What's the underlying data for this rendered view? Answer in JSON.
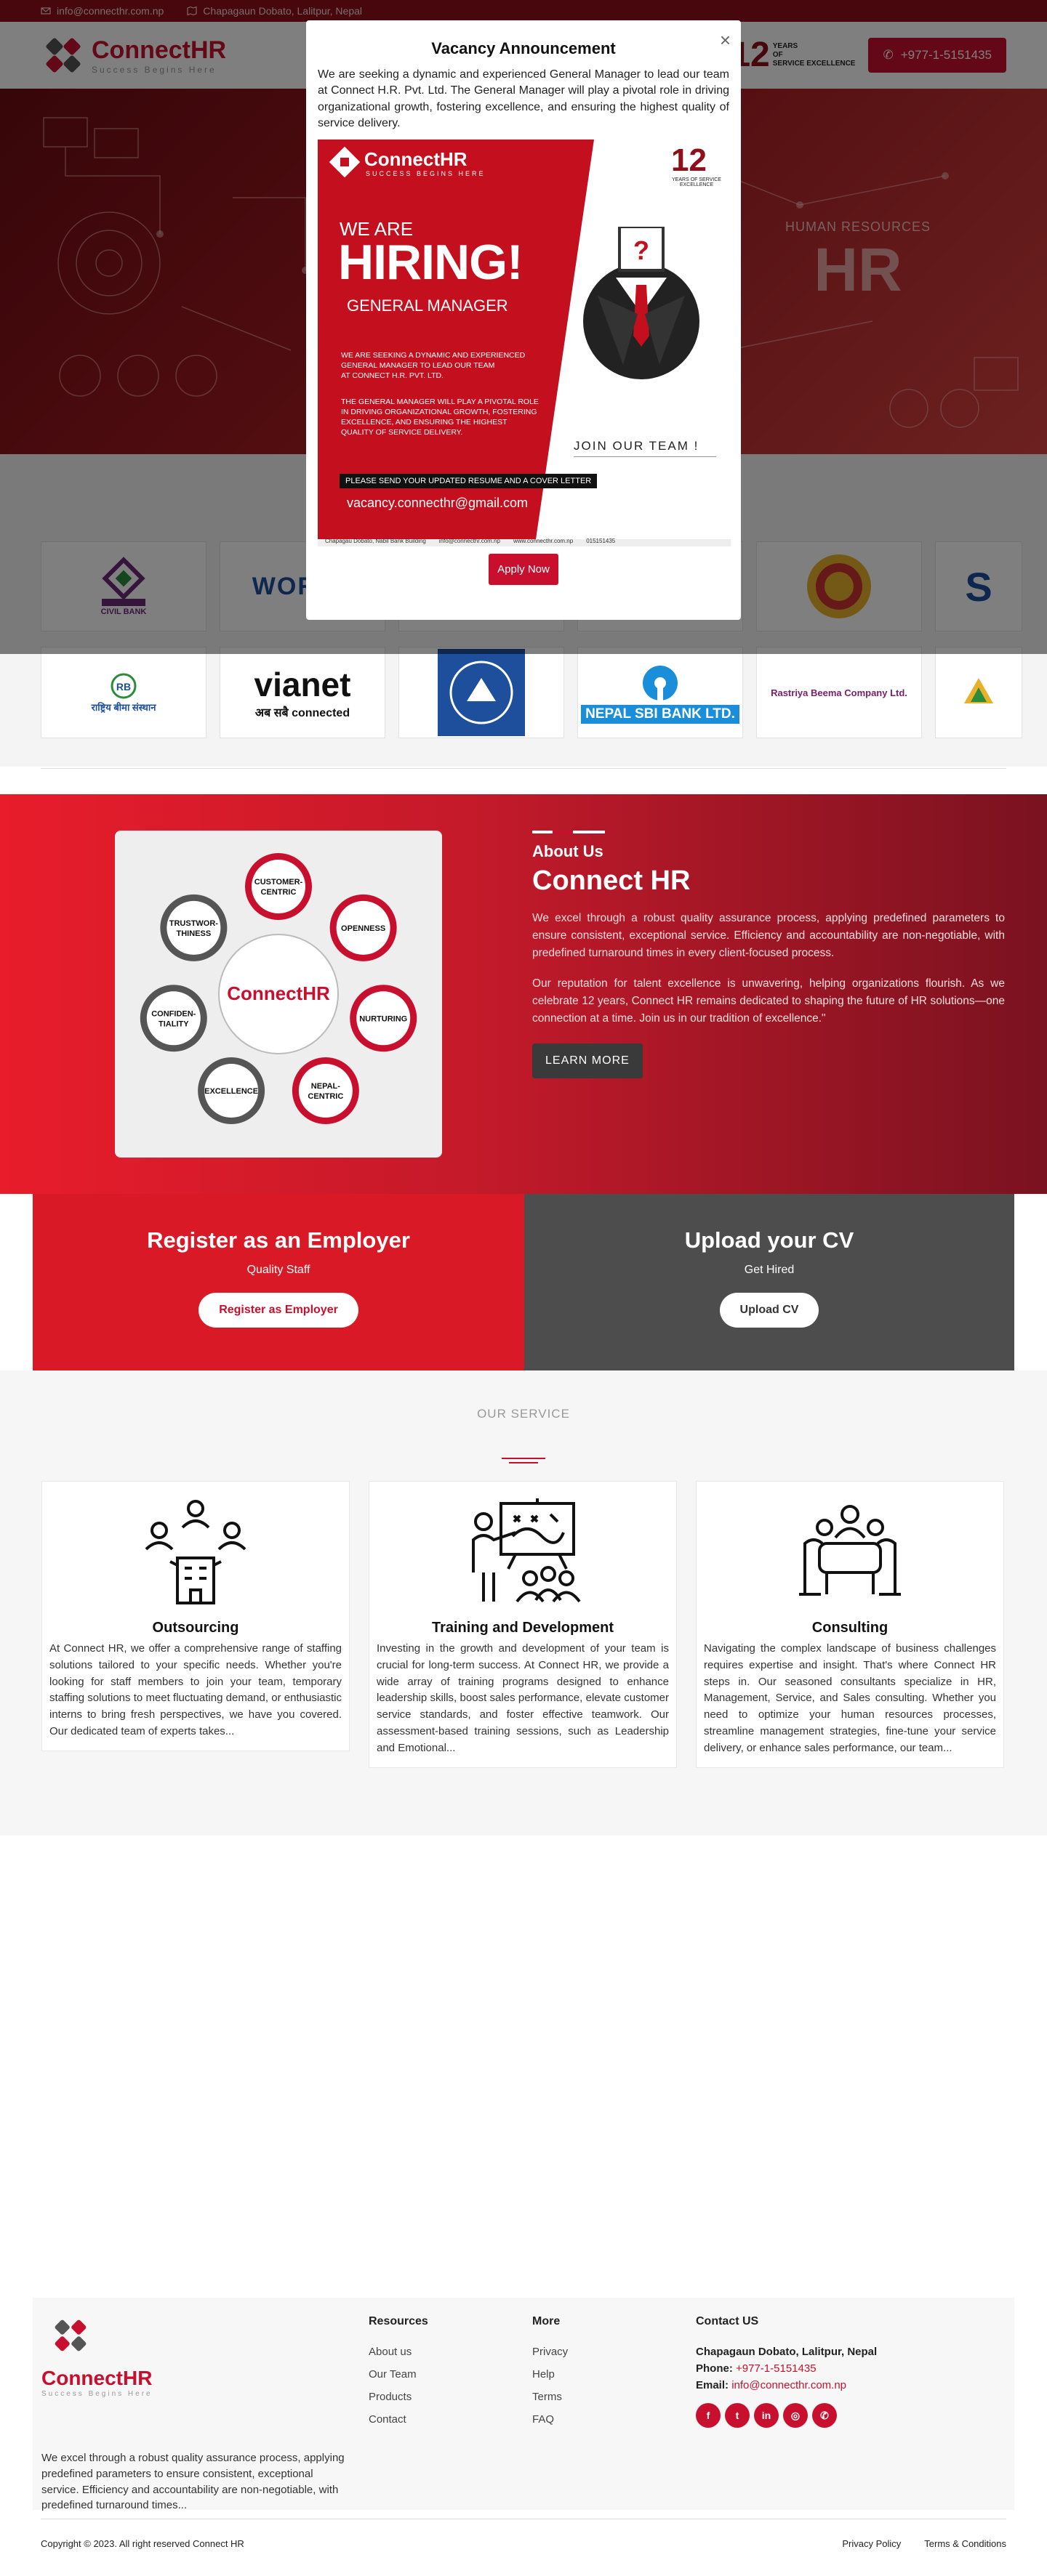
{
  "topbar": {
    "email": "info@connecthr.com.np",
    "address": "Chapagaun Dobato, Lalitpur, Nepal"
  },
  "header": {
    "brand": "ConnectHR",
    "tagline": "Success Begins Here",
    "years_num": "12",
    "years_label_1": "YEARS",
    "years_label_2": "OF",
    "years_label_3": "SERVICE EXCELLENCE",
    "phone": "+977-1-5151435"
  },
  "hero": {
    "label": "HUMAN RESOURCES",
    "big": "HR"
  },
  "clients": {
    "row1": [
      "CIVIL BANK",
      "WORLD",
      "",
      "",
      "",
      "S"
    ],
    "row2": [
      "राष्ट्रिय बीमा संस्थान",
      "vianet",
      "",
      "NEPAL SBI BANK LTD.",
      "Rastriya Beema Company Ltd.",
      ""
    ],
    "vianet_sub": "अब सबै connected"
  },
  "about": {
    "kicker": "About Us",
    "title": "Connect HR",
    "p1": "We excel through a robust quality assurance process, applying predefined parameters to ensure consistent, exceptional service. Efficiency and accountability are non-negotiable, with predefined turnaround times in every client-focused process.",
    "p2": "Our reputation for talent excellence is unwavering, helping organizations flourish. As we celebrate 12 years, Connect HR remains dedicated to shaping the future of HR solutions—one connection at a time. Join us in our tradition of excellence.\"",
    "button": "LEARN MORE",
    "values": [
      "CUSTOMER-CENTRIC",
      "OPENNESS",
      "NURTURING",
      "NEPAL-CENTRIC",
      "EXCELLENCE",
      "CONFIDEN-TIALITY",
      "TRUSTWOR-THINESS"
    ]
  },
  "cta": {
    "employer_title": "Register as an Employer",
    "employer_sub": "Quality Staff",
    "employer_btn": "Register as Employer",
    "cv_title": "Upload your CV",
    "cv_sub": "Get Hired",
    "cv_btn": "Upload CV"
  },
  "services": {
    "kicker": "OUR SERVICE",
    "items": [
      {
        "title": "Outsourcing",
        "icon": "organization-people-icon",
        "text": "At Connect HR, we offer a comprehensive range of staffing solutions tailored to your specific needs. Whether you're looking for  staff members to join your team, temporary staffing solutions to meet fluctuating demand, or enthusiastic interns to bring fresh perspectives, we have you covered. Our dedicated team of experts takes..."
      },
      {
        "title": "Training and Development",
        "icon": "trainer-whiteboard-icon",
        "text": "Investing in the growth and development of your team is crucial for long-term success. At Connect HR, we provide a wide array of training programs designed to enhance leadership skills, boost sales performance, elevate customer service standards, and foster effective teamwork. Our assessment-based training sessions, such as Leadership and Emotional..."
      },
      {
        "title": "Consulting",
        "icon": "meeting-table-icon",
        "text": "Navigating the complex landscape of business challenges requires expertise and insight. That's where Connect HR steps in. Our seasoned consultants specialize in HR, Management, Service, and Sales consulting. Whether you need to optimize your human resources processes, streamline management strategies, fine-tune your service delivery, or enhance sales performance, our team..."
      }
    ]
  },
  "footer": {
    "about": "We excel through a robust quality assurance process, applying predefined parameters to ensure consistent, exceptional service. Efficiency and accountability are non-negotiable, with predefined turnaround times...",
    "resources_title": "Resources",
    "resources": [
      "About us",
      "Our Team",
      "Products",
      "Contact"
    ],
    "more_title": "More",
    "more": [
      "Privacy",
      "Help",
      "Terms",
      "FAQ"
    ],
    "contact_title": "Contact US",
    "contact_address": "Chapagaun Dobato, Lalitpur, Nepal",
    "contact_phone_label": "Phone:",
    "contact_phone": "+977-1-5151435",
    "contact_email_label": "Email:",
    "contact_email": "info@connecthr.com.np",
    "socials": [
      "facebook-icon",
      "twitter-icon",
      "linkedin-icon",
      "instagram-icon",
      "whatsapp-icon"
    ],
    "copyright": "Copyright © 2023. All right reserved Connect HR",
    "privacy": "Privacy Policy",
    "terms": "Terms & Conditions"
  },
  "modal": {
    "title": "Vacancy Announcement",
    "text": "We are seeking a dynamic and experienced General Manager to lead our team at Connect H.R. Pvt. Ltd. The General Manager will play a pivotal role in driving organizational growth, fostering excellence, and ensuring the highest quality of service delivery.",
    "close": "×",
    "apply": "Apply Now",
    "poster": {
      "brand": "ConnectHR",
      "tagline": "SUCCESS BEGINS HERE",
      "years": "12",
      "years_label": "YEARS OF SERVICE EXCELLENCE",
      "we_are": "WE ARE",
      "hiring": "HIRING!",
      "position": "GENERAL MANAGER",
      "para1_l1": "WE ARE SEEKING A DYNAMIC AND EXPERIENCED",
      "para1_l2": "GENERAL MANAGER TO LEAD OUR TEAM",
      "para1_l3": "AT CONNECT H.R. PVT. LTD.",
      "para2_l1": "THE GENERAL MANAGER WILL PLAY A PIVOTAL ROLE",
      "para2_l2": "IN DRIVING ORGANIZATIONAL GROWTH, FOSTERING",
      "para2_l3": "EXCELLENCE, AND ENSURING THE HIGHEST",
      "para2_l4": "QUALITY OF SERVICE DELIVERY.",
      "send": "PLEASE SEND YOUR UPDATED RESUME AND A COVER LETTER",
      "email": "vacancy.connecthr@gmail.com",
      "join": "JOIN OUR TEAM !",
      "foot_address": "Chapagau Dobato, Nabil Bank Building",
      "foot_email": "info@connecthr.com.np",
      "foot_web": "www.connecthr.com.np",
      "foot_phone": "015151435"
    }
  }
}
